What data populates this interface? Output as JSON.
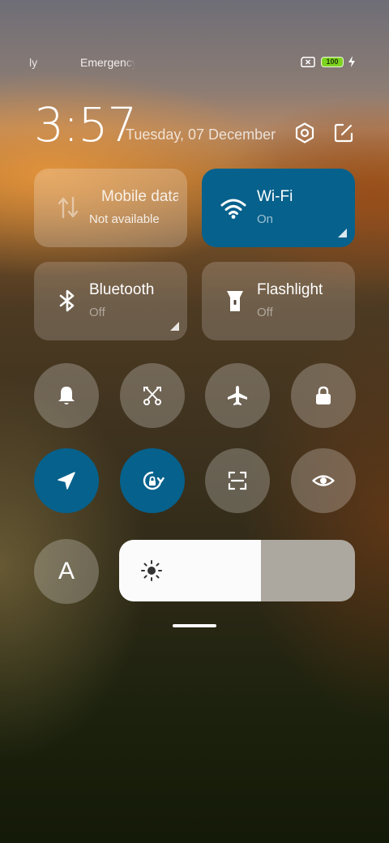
{
  "status_bar": {
    "left_text": "ly",
    "mid_text": "Emergency calls only",
    "battery_level": "100",
    "sim_icon": "no-sim-icon",
    "charging_icon": "charging-bolt-icon"
  },
  "header": {
    "time": "3:57",
    "date": "Tuesday, 07 December",
    "settings_icon": "settings-hexagon-icon",
    "edit_icon": "edit-icon"
  },
  "tiles": [
    {
      "label": "Mobile data",
      "status": "Not available",
      "icon": "mobile-data-icon",
      "state": "disabled"
    },
    {
      "label": "Wi-Fi",
      "status": "On",
      "icon": "wifi-icon",
      "state": "on"
    },
    {
      "label": "Bluetooth",
      "status": "Off",
      "icon": "bluetooth-icon",
      "state": "off"
    },
    {
      "label": "Flashlight",
      "status": "Off",
      "icon": "flashlight-icon",
      "state": "off"
    }
  ],
  "toggles_row1": [
    {
      "icon": "bell-icon",
      "state": "off"
    },
    {
      "icon": "screenshot-scissors-icon",
      "state": "off"
    },
    {
      "icon": "airplane-icon",
      "state": "off"
    },
    {
      "icon": "lock-icon",
      "state": "off"
    }
  ],
  "toggles_row2": [
    {
      "icon": "location-icon",
      "state": "on"
    },
    {
      "icon": "rotation-lock-icon",
      "state": "on"
    },
    {
      "icon": "scan-icon",
      "state": "off"
    },
    {
      "icon": "eye-icon",
      "state": "off"
    }
  ],
  "auto_brightness": {
    "label": "A",
    "state": "off"
  },
  "brightness": {
    "level": 0.6,
    "icon": "sun-icon"
  },
  "colors": {
    "accent_on": "#06618c",
    "battery": "#7ed321"
  }
}
